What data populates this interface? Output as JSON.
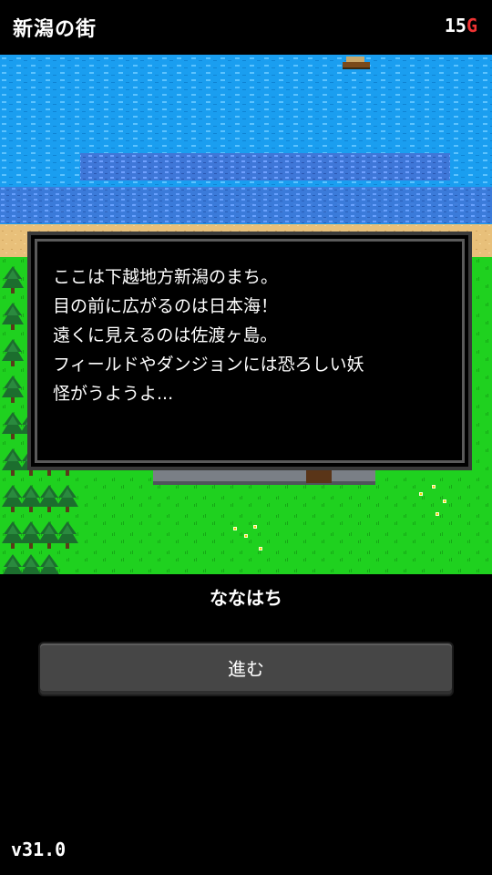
{
  "header": {
    "town_name": "新潟の街",
    "gold_amount": "15",
    "gold_unit": "G"
  },
  "dialog": {
    "text": "ここは下越地方新潟のまち。\n目の前に広がるのは日本海！\n遠くに見えるのは佐渡ヶ島。\nフィールドやダンジョンには恐ろしい妖\n怪がうようよ..."
  },
  "speaker": "ななはち",
  "advance_button": {
    "label": "進む"
  },
  "version": "v31.0",
  "colors": {
    "sea": "#1a9ef0",
    "sea_dark": "#3b6fd6",
    "sand": "#e8c07a",
    "grass": "#1fd11f",
    "tree": "#1a6a2a",
    "stone": "#7a7f86",
    "gold_unit": "#ee3333"
  }
}
